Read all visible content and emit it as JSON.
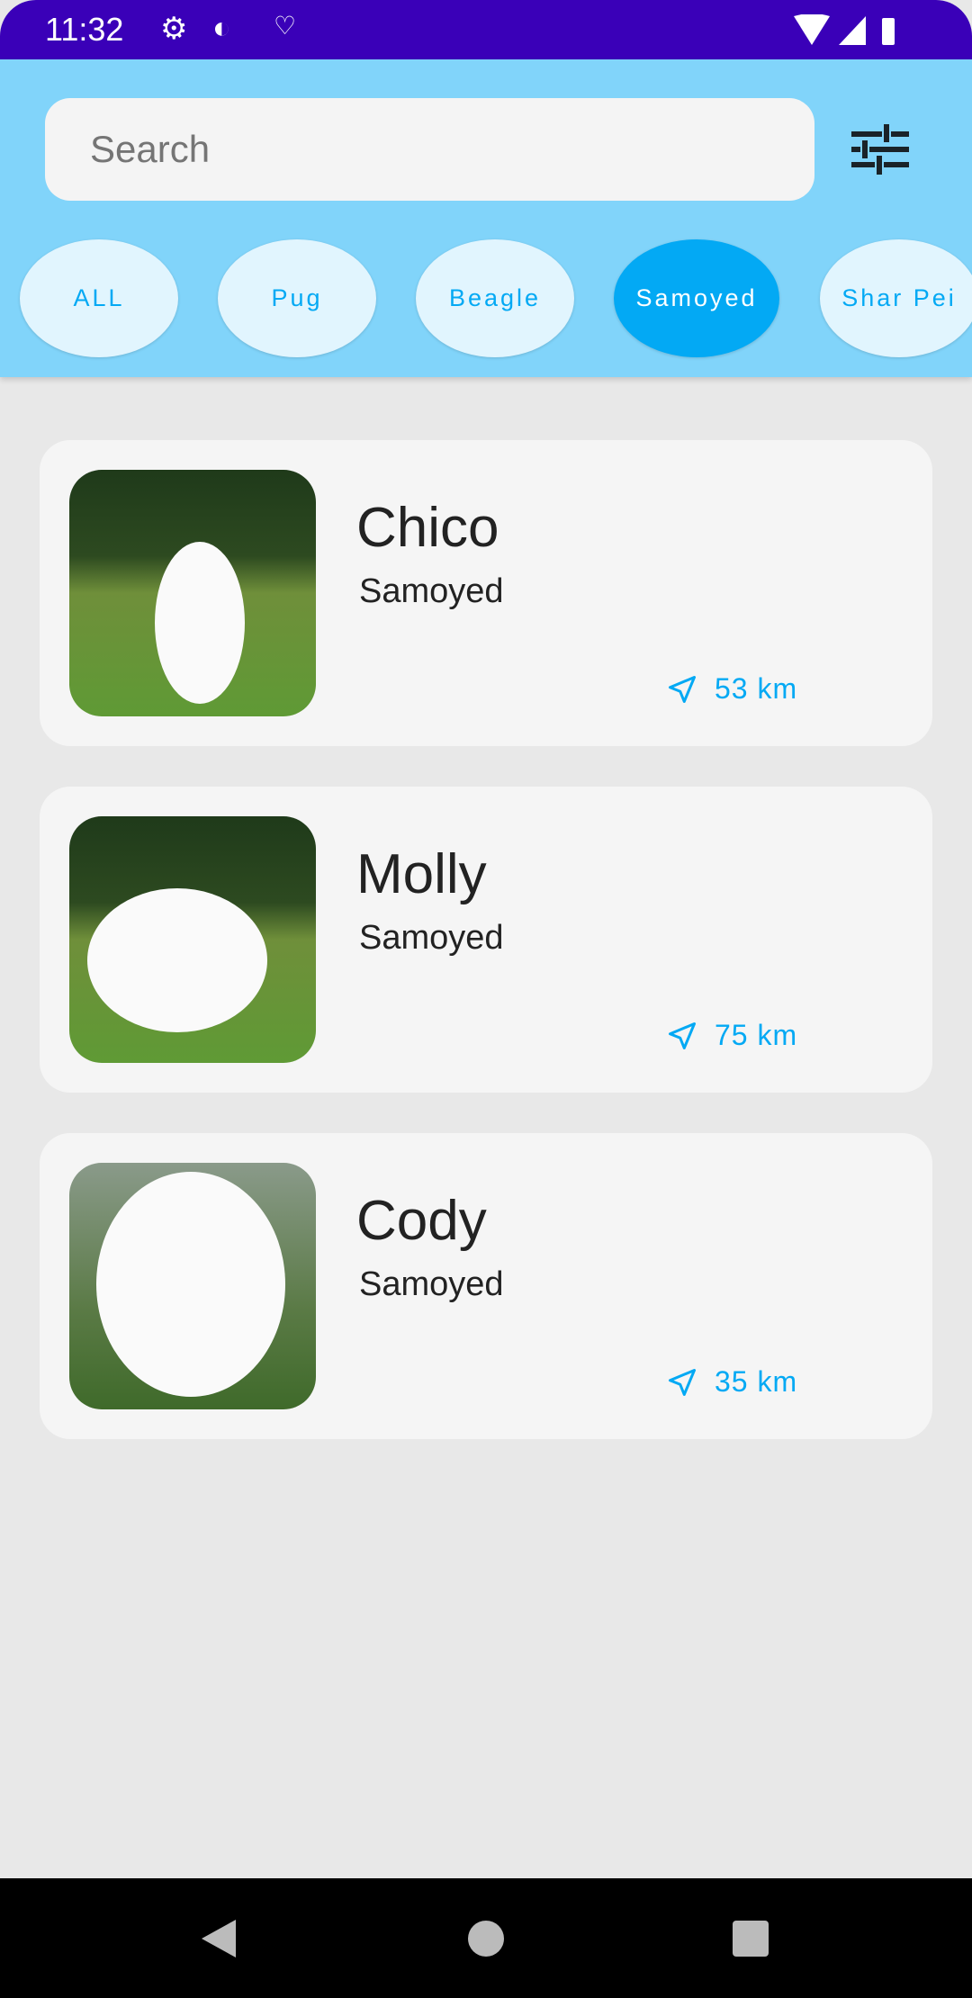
{
  "status_bar": {
    "time": "11:32",
    "icons": [
      "gear-icon",
      "sync-icon",
      "accessibility-icon",
      "wifi-icon",
      "signal-icon",
      "battery-icon"
    ]
  },
  "search": {
    "placeholder": "Search"
  },
  "filter_icon": "tune-icon",
  "chips": [
    {
      "label": "ALL",
      "selected": false
    },
    {
      "label": "Pug",
      "selected": false
    },
    {
      "label": "Beagle",
      "selected": false
    },
    {
      "label": "Samoyed",
      "selected": true
    },
    {
      "label": "Shar Pei",
      "selected": false
    }
  ],
  "dogs": [
    {
      "name": "Chico",
      "breed": "Samoyed",
      "distance": "53 km"
    },
    {
      "name": "Molly",
      "breed": "Samoyed",
      "distance": "75 km"
    },
    {
      "name": "Cody",
      "breed": "Samoyed",
      "distance": "35 km"
    }
  ],
  "colors": {
    "accent": "#03A9F4",
    "header": "#81D4FA",
    "status_bar": "#3A00B8",
    "chip": "#E1F5FE"
  }
}
